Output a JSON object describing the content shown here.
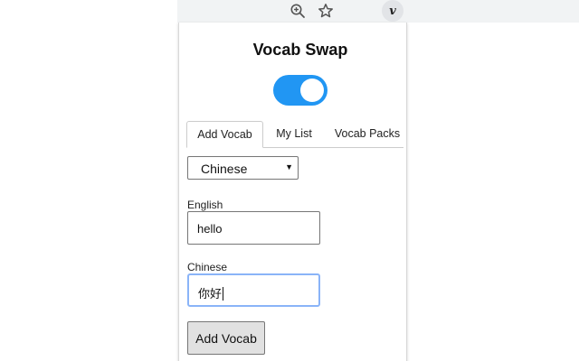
{
  "browser": {
    "extension_icon_letter": "v",
    "icons": [
      "zoom-icon",
      "star-icon",
      "extension-icon"
    ]
  },
  "popup": {
    "title": "Vocab Swap",
    "toggle": {
      "on": true,
      "color": "#2196f3"
    },
    "tabs": [
      {
        "label": "Add Vocab",
        "active": true
      },
      {
        "label": "My List",
        "active": false
      },
      {
        "label": "Vocab Packs",
        "active": false
      }
    ],
    "language_select": {
      "selected": "Chinese"
    },
    "english_field": {
      "label": "English",
      "value": "hello"
    },
    "chinese_field": {
      "label": "Chinese",
      "value": "你好"
    },
    "add_button_label": "Add Vocab"
  },
  "colors": {
    "accent": "#2196f3",
    "focus_border": "#8ab4f8",
    "button_bg": "#e1e1e1"
  }
}
